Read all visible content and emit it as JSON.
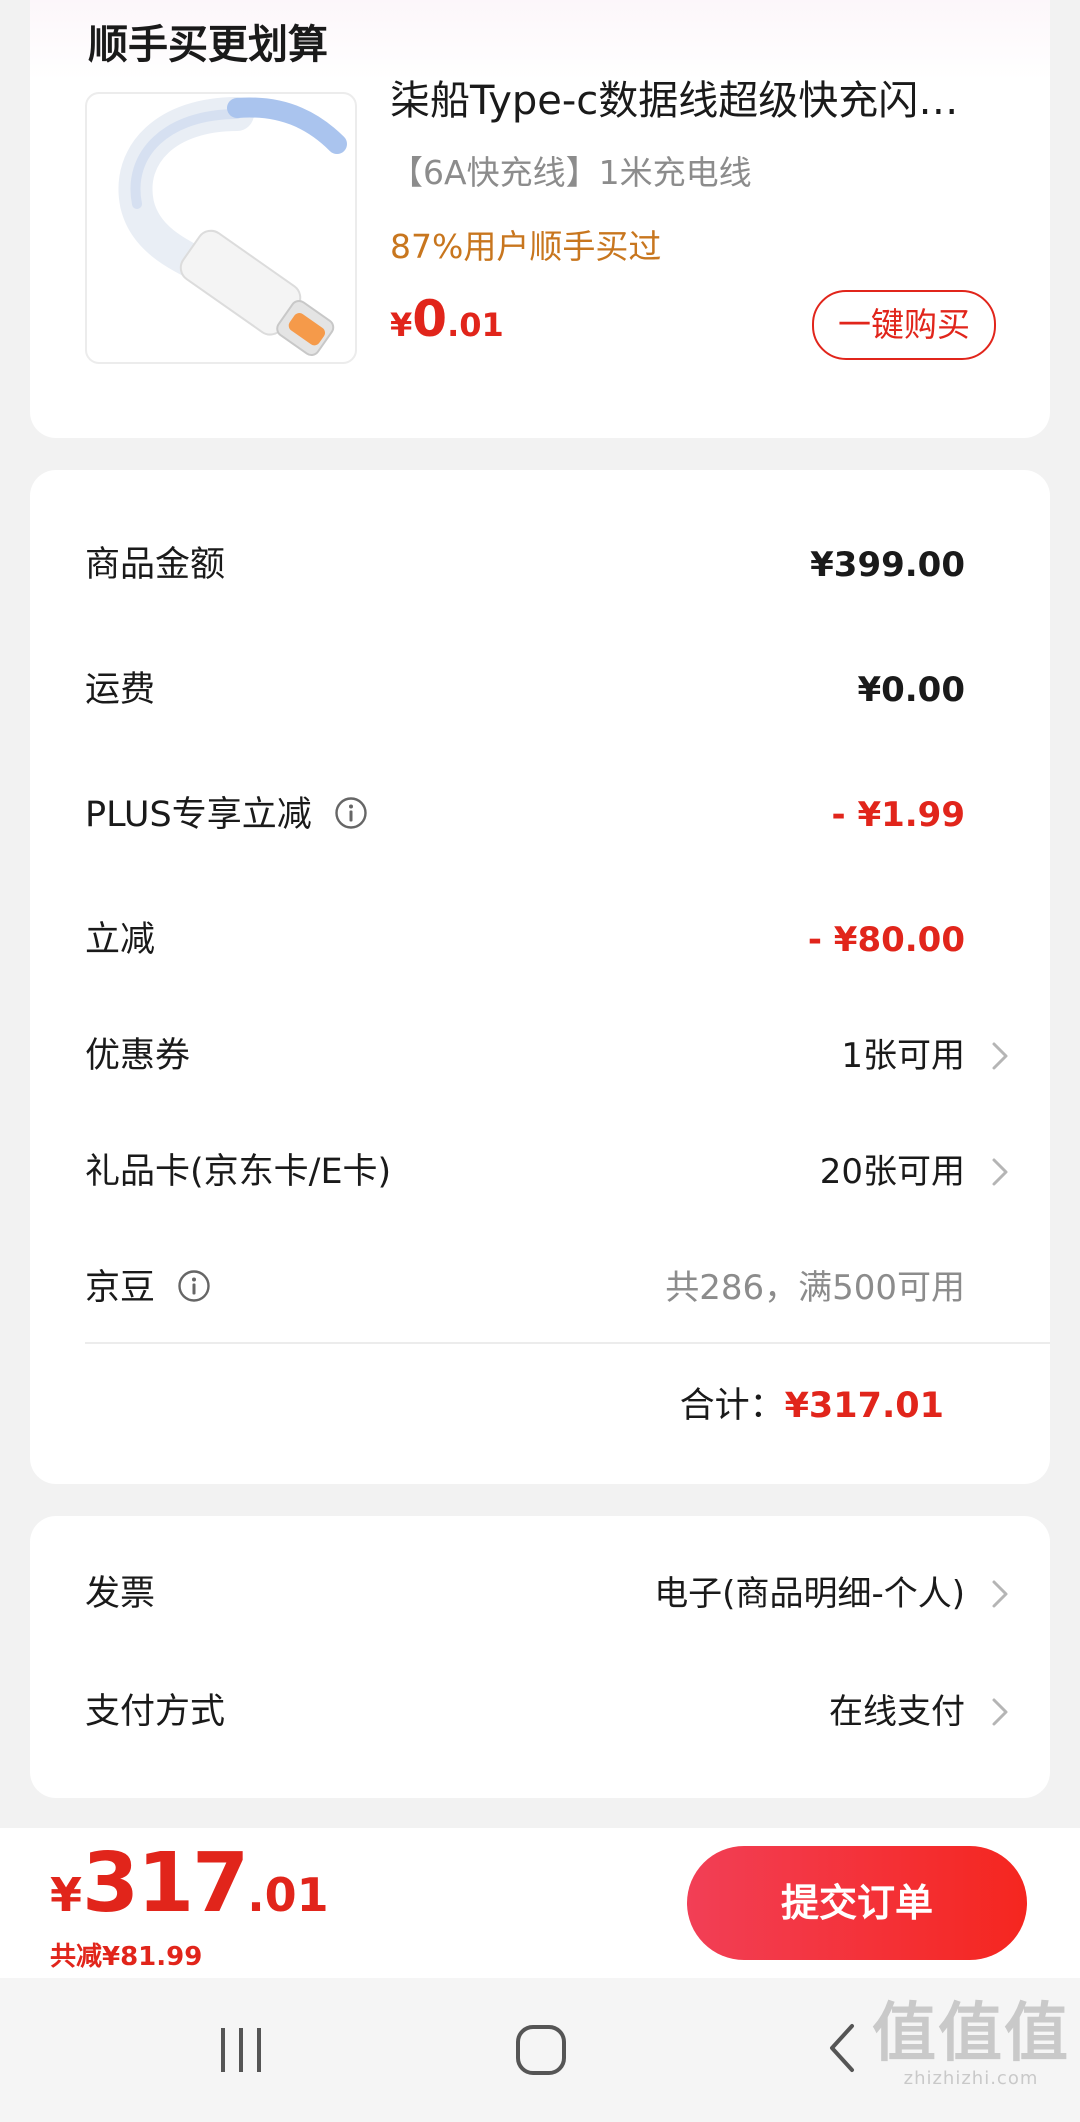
{
  "upsell": {
    "title": "顺手买更划算",
    "product": {
      "title": "柒船Type-c数据线超级快充闪充闪充数据线",
      "spec": "【6A快充线】1米充电线",
      "bought": "87%用户顺手买过",
      "price_symbol": "¥",
      "price_int": "0",
      "price_dec": ".01",
      "buy_label": "一键购买",
      "image_icon": "usb-c-cable-icon"
    }
  },
  "summary": {
    "rows": [
      {
        "label": "商品金额",
        "value": "¥399.00"
      },
      {
        "label": "运费",
        "value": "¥0.00"
      },
      {
        "label": "PLUS专享立减",
        "value": "- ¥1.99"
      },
      {
        "label": "立减",
        "value": "- ¥80.00"
      },
      {
        "label": "优惠券",
        "value": "1张可用"
      },
      {
        "label": "礼品卡(京东卡/E卡)",
        "value": "20张可用"
      },
      {
        "label": "京豆",
        "value": "共286，满500可用"
      }
    ],
    "total_label": "合计：",
    "total_value": "¥317.01"
  },
  "invoice": {
    "label": "发票",
    "value": "电子(商品明细-个人)"
  },
  "payment": {
    "label": "支付方式",
    "value": "在线支付"
  },
  "bottom_bar": {
    "symbol": "¥",
    "amount_int": "317",
    "amount_dec": ".01",
    "saved": "共减¥81.99",
    "submit_label": "提交订单"
  },
  "nav": {
    "icons": [
      "recent-apps-icon",
      "home-icon",
      "back-icon"
    ]
  },
  "watermark": {
    "big": "值值值",
    "small": "zhizhizhi.com"
  },
  "colors": {
    "accent_red": "#e1251b",
    "orange": "#c8761e",
    "gray_text": "#8c8c8c",
    "page_bg": "#f2f2f2"
  }
}
